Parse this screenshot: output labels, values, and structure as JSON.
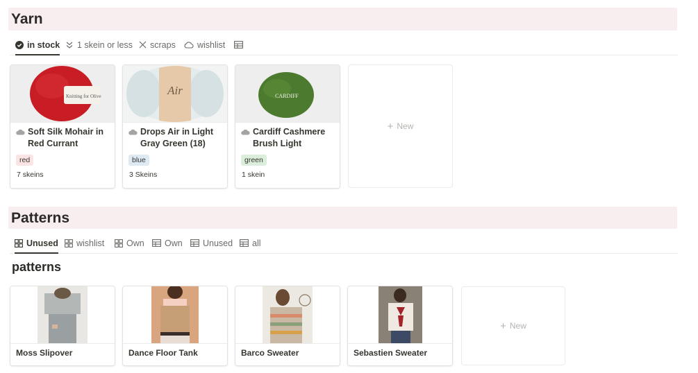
{
  "yarn": {
    "title": "Yarn",
    "tabs": [
      {
        "label": "in stock",
        "icon": "check-circle-icon",
        "active": true
      },
      {
        "label": "1 skein or less",
        "icon": "double-chevron-down-icon",
        "active": false
      },
      {
        "label": "scraps",
        "icon": "x-icon",
        "active": false
      },
      {
        "label": "wishlist",
        "icon": "cloud-icon",
        "active": false
      },
      {
        "label": "",
        "icon": "table-icon",
        "active": false
      }
    ],
    "cards": [
      {
        "title": "Soft Silk Mohair in Red Currant",
        "tag": "red",
        "tag_color": "#fbe4e4",
        "count": "7 skeins",
        "cover_label": "Knitting for Olive"
      },
      {
        "title": "Drops Air in Light Gray Green (18)",
        "tag": "blue",
        "tag_color": "#dde9f3",
        "count": "3 Skeins",
        "cover_label": "Air"
      },
      {
        "title": "Cardiff Cashmere Brush Light",
        "tag": "green",
        "tag_color": "#dbeddb",
        "count": "1 skein",
        "cover_label": "CARDIFF"
      }
    ],
    "new_label": "New"
  },
  "patterns": {
    "title": "Patterns",
    "tabs": [
      {
        "label": "Unused",
        "icon": "gallery-icon",
        "active": true
      },
      {
        "label": "wishlist",
        "icon": "gallery-icon",
        "active": false
      },
      {
        "label": "Own",
        "icon": "gallery-icon",
        "active": false
      },
      {
        "label": "Own",
        "icon": "table-icon",
        "active": false
      },
      {
        "label": "Unused",
        "icon": "table-icon",
        "active": false
      },
      {
        "label": "all",
        "icon": "table-icon",
        "active": false
      }
    ],
    "group_title": "patterns",
    "cards": [
      {
        "name": "Moss Slipover"
      },
      {
        "name": "Dance Floor Tank"
      },
      {
        "name": "Barco Sweater"
      },
      {
        "name": "Sebastien Sweater"
      }
    ],
    "new_label": "New"
  },
  "colors": {
    "header_bg": "#f8eeef",
    "text": "#37352f",
    "muted": "#6b6a66"
  }
}
